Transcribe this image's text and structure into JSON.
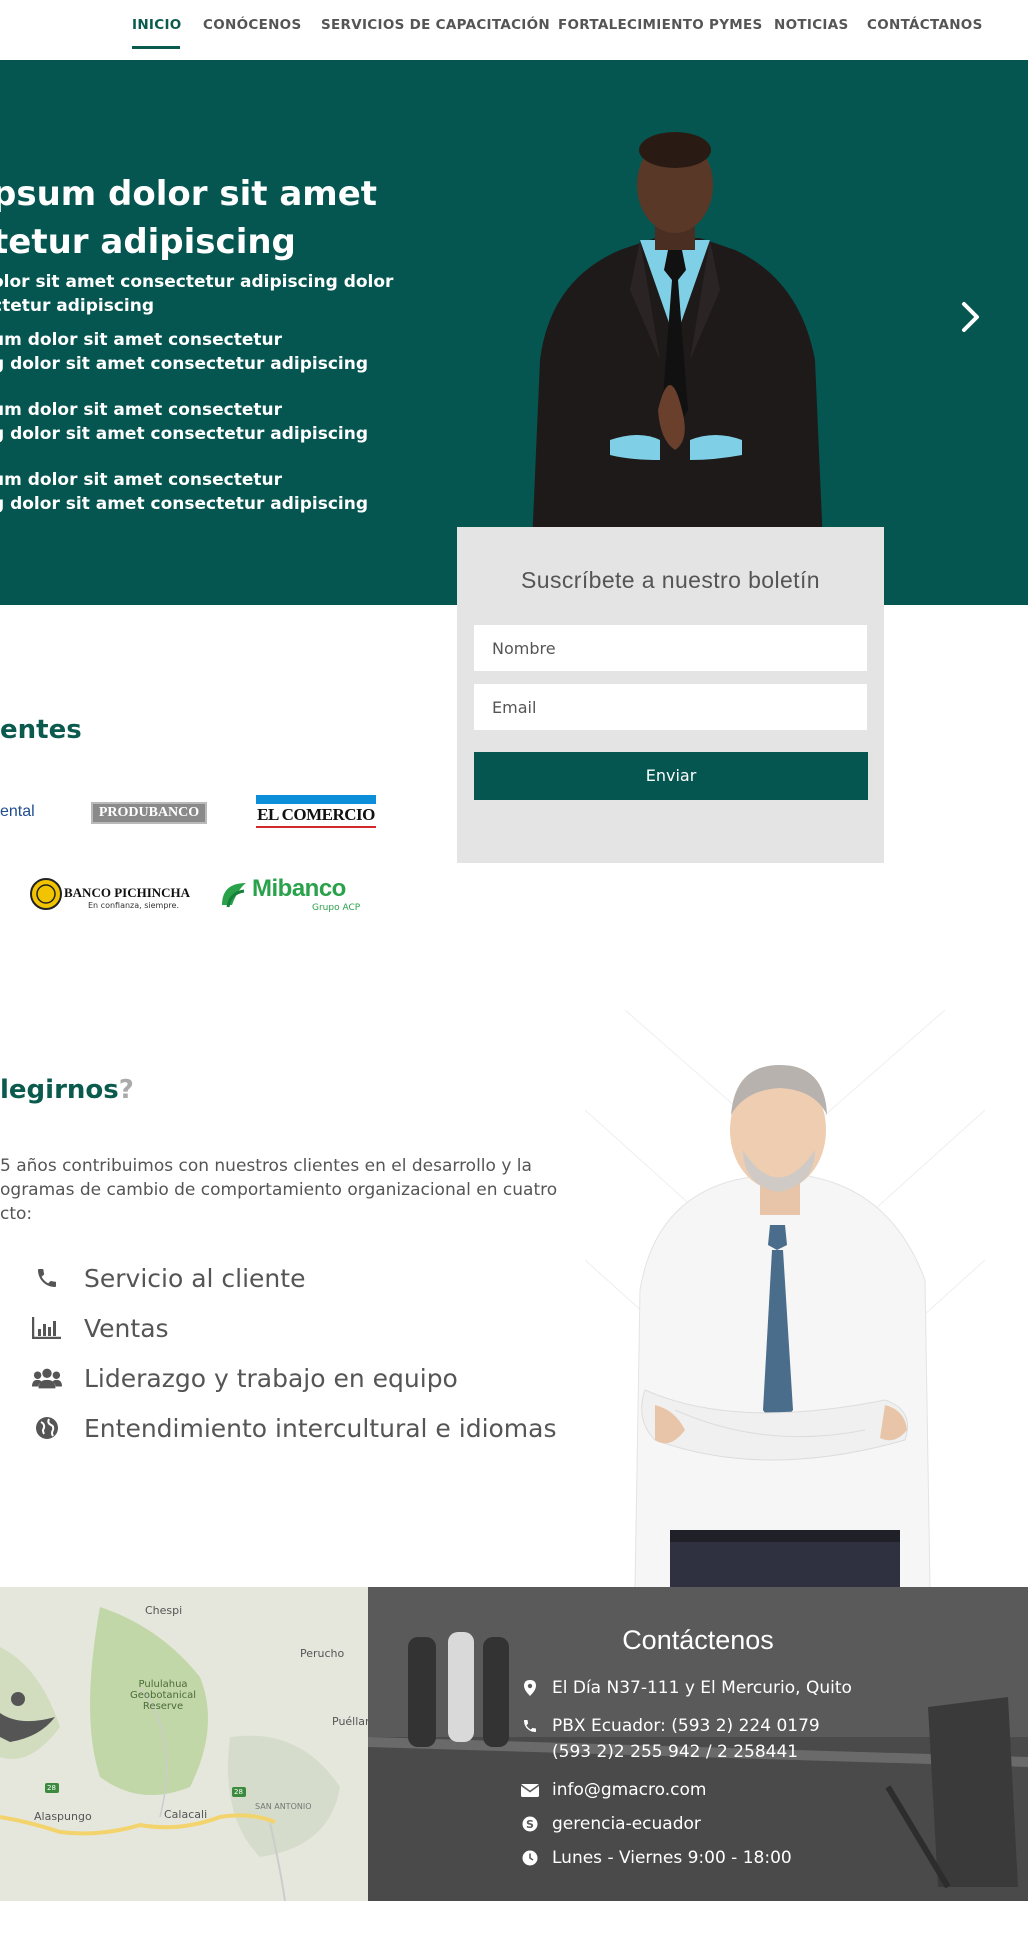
{
  "nav": {
    "items": [
      {
        "label": "INICIO",
        "active": true
      },
      {
        "label": "CONÓCENOS"
      },
      {
        "label": "SERVICIOS DE CAPACITACIÓN"
      },
      {
        "label": "FORTALECIMIENTO PYMES"
      },
      {
        "label": "NOTICIAS"
      },
      {
        "label": "CONTÁCTANOS"
      }
    ]
  },
  "hero": {
    "title_line1": "psum dolor sit amet",
    "title_line2": "tetur adipiscing",
    "sub_line1": "olor sit amet consectetur adipiscing dolor",
    "sub_line2": "ctetur adipiscing",
    "items": [
      {
        "line1": "um dolor sit amet consectetur",
        "line2": "g dolor sit amet consectetur adipiscing"
      },
      {
        "line1": "um dolor sit amet consectetur",
        "line2": "g dolor sit amet consectetur adipiscing"
      },
      {
        "line1": "um dolor sit amet consectetur",
        "line2": "g dolor sit amet consectetur adipiscing"
      }
    ],
    "next_icon": "chevron-right-icon",
    "bg_color": "#055650"
  },
  "newsletter": {
    "title": "Suscríbete a nuestro boletín",
    "name_placeholder": "Nombre",
    "email_placeholder": "Email",
    "submit_label": "Enviar"
  },
  "clients": {
    "title": "entes",
    "logos": [
      "ental",
      "PRODUBANCO",
      "EL COMERCIO",
      "BANCO PICHINCHA",
      "En confianza, siempre.",
      "Mibanco",
      "Grupo ACP"
    ]
  },
  "why": {
    "title": "legirnos",
    "title_mark": "?",
    "desc_line1": "5 años contribuimos con nuestros clientes en el desarrollo y la",
    "desc_line2": "ogramas de cambio de comportamiento organizacional en cuatro",
    "desc_line3": "cto:",
    "features": [
      {
        "icon": "phone-icon",
        "label": "Servicio al cliente"
      },
      {
        "icon": "bar-chart-icon",
        "label": "Ventas"
      },
      {
        "icon": "users-icon",
        "label": "Liderazgo y trabajo en equipo"
      },
      {
        "icon": "globe-icon",
        "label": "Entendimiento intercultural e idiomas"
      }
    ]
  },
  "map": {
    "labels": [
      "Chespi",
      "Perucho",
      "Pululahua",
      "Geobotanical",
      "Reserve",
      "Puéllar",
      "Alaspungo",
      "Calacali",
      "SAN ANTONIO",
      "28",
      "28"
    ]
  },
  "contact": {
    "title": "Contáctenos",
    "address": "El Día N37-111 y El Mercurio, Quito",
    "phone1": "PBX Ecuador: (593 2) 224 0179",
    "phone2": "(593 2)2 255 942 / 2 258441",
    "email": "info@gmacro.com",
    "skype": "gerencia-ecuador",
    "hours": "Lunes - Viernes 9:00 - 18:00"
  }
}
